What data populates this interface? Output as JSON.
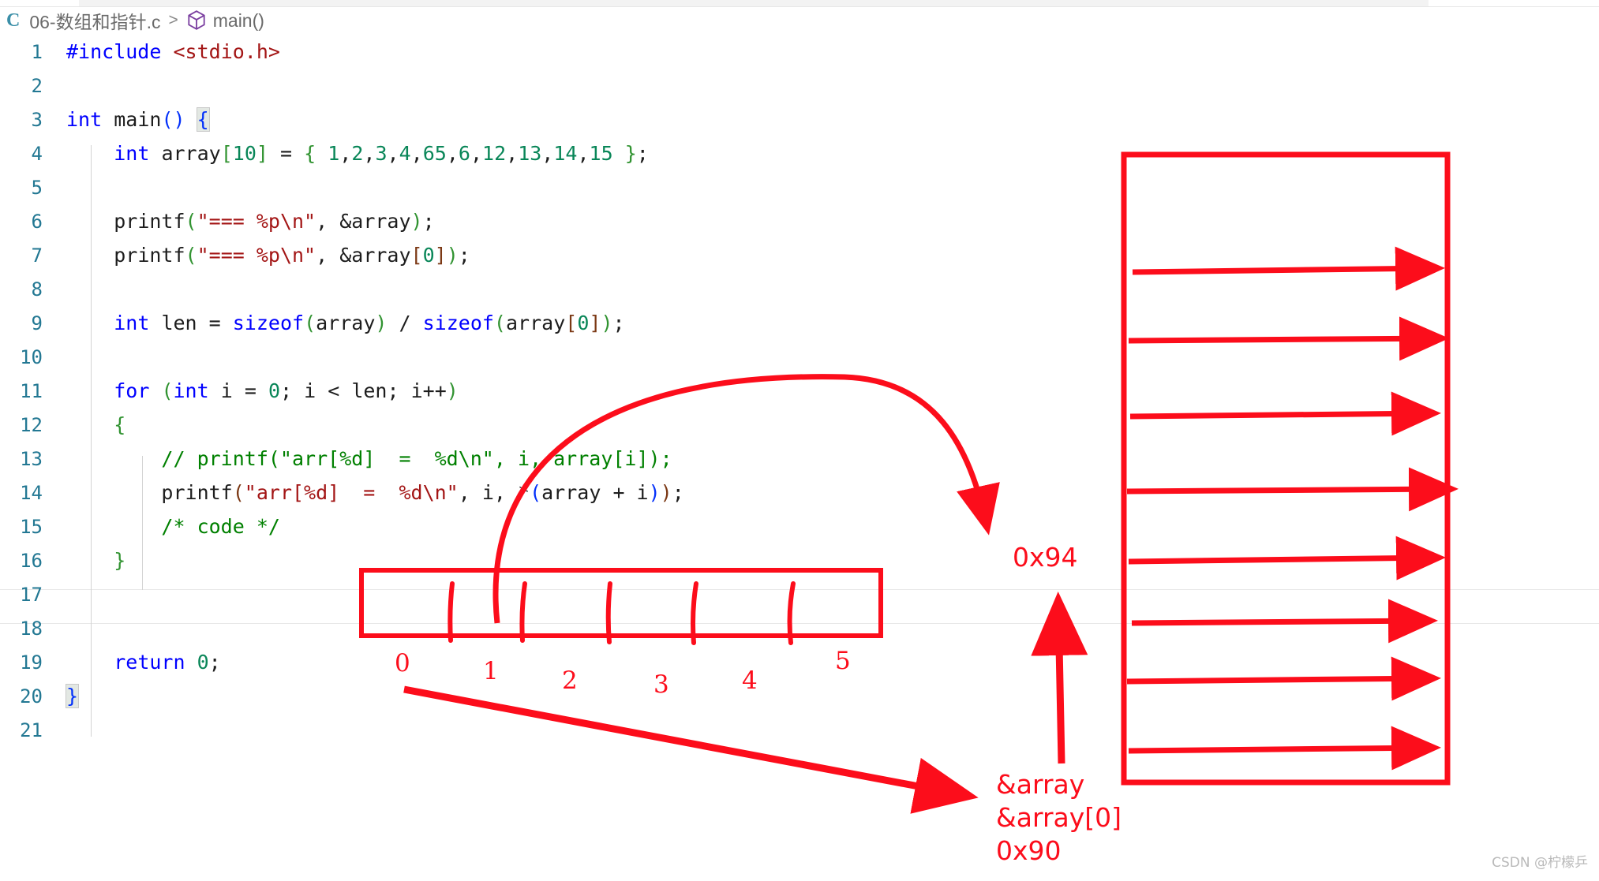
{
  "breadcrumb": {
    "lang_badge": "C",
    "file_name": "06-数组和指针.c",
    "separator": ">",
    "symbol_icon": "cube-icon",
    "symbol_name": "main()"
  },
  "editor": {
    "lines": [
      {
        "no": "1",
        "text": "#include <stdio.h>"
      },
      {
        "no": "2",
        "text": ""
      },
      {
        "no": "3",
        "text": "int main() {"
      },
      {
        "no": "4",
        "text": "    int array[10] = { 1,2,3,4,65,6,12,13,14,15 };"
      },
      {
        "no": "5",
        "text": ""
      },
      {
        "no": "6",
        "text": "    printf(\"=== %p\\n\", &array);"
      },
      {
        "no": "7",
        "text": "    printf(\"=== %p\\n\", &array[0]);"
      },
      {
        "no": "8",
        "text": ""
      },
      {
        "no": "9",
        "text": "    int len = sizeof(array) / sizeof(array[0]);"
      },
      {
        "no": "10",
        "text": ""
      },
      {
        "no": "11",
        "text": "    for (int i = 0; i < len; i++)"
      },
      {
        "no": "12",
        "text": "    {"
      },
      {
        "no": "13",
        "text": "        // printf(\"arr[%d]  =  %d\\n\", i, array[i]);"
      },
      {
        "no": "14",
        "text": "        printf(\"arr[%d]  =  %d\\n\", i, *(array + i));"
      },
      {
        "no": "15",
        "text": "        /* code */"
      },
      {
        "no": "16",
        "text": "    }"
      },
      {
        "no": "17",
        "text": ""
      },
      {
        "no": "18",
        "text": ""
      },
      {
        "no": "19",
        "text": "    return 0;"
      },
      {
        "no": "20",
        "text": "}"
      },
      {
        "no": "21",
        "text": ""
      }
    ]
  },
  "annotations": {
    "color": "#fc0d1b",
    "addr_top": "0x94",
    "addr_bottom_lines": [
      "&array",
      "&array[0]",
      "0x90"
    ],
    "index_labels": [
      "0",
      "1",
      "2",
      "3",
      "4",
      "5"
    ]
  },
  "watermark": "CSDN @柠檬乒"
}
